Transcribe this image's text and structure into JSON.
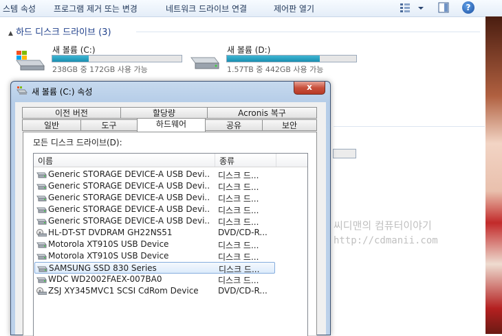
{
  "toolbar": {
    "items": [
      "스템 속성",
      "프로그램 제거 또는 변경",
      "네트워크 드라이브 연결",
      "제어판 열기"
    ],
    "help_label": "?"
  },
  "explorer": {
    "section_title": "하드 디스크 드라이브 (3)",
    "drives": [
      {
        "name": "새 볼륨 (C:)",
        "space": "238GB 중 172GB 사용 가능",
        "used_fraction": 0.28
      },
      {
        "name": "새 볼륨 (D:)",
        "space": "1.57TB 중 442GB 사용 가능",
        "used_fraction": 0.72
      }
    ],
    "watermark_title": "씨디맨의 컴퓨터이야기",
    "watermark_url": "http://cdmanii.com"
  },
  "dialog": {
    "title": "새 볼륨 (C:) 속성",
    "close_label": "x",
    "tabs_row1": [
      "이전 버전",
      "할당량",
      "Acronis 복구"
    ],
    "tabs_row2": [
      "일반",
      "도구",
      "하드웨어",
      "공유",
      "보안"
    ],
    "active_tab": "하드웨어",
    "panel_label": "모든 디스크 드라이브(D):",
    "columns": [
      "이름",
      "종류"
    ],
    "devices": [
      {
        "name": "Generic STORAGE DEVICE-A USB Devi...",
        "type": "디스크 드...",
        "icon": "hdd-icon"
      },
      {
        "name": "Generic STORAGE DEVICE-A USB Devi...",
        "type": "디스크 드...",
        "icon": "hdd-icon"
      },
      {
        "name": "Generic STORAGE DEVICE-A USB Devi...",
        "type": "디스크 드...",
        "icon": "hdd-icon"
      },
      {
        "name": "Generic STORAGE DEVICE-A USB Devi...",
        "type": "디스크 드...",
        "icon": "hdd-icon"
      },
      {
        "name": "Generic STORAGE DEVICE-A USB Devi...",
        "type": "디스크 드...",
        "icon": "hdd-icon"
      },
      {
        "name": "HL-DT-ST DVDRAM GH22NS51",
        "type": "DVD/CD-R...",
        "icon": "optical-drive-icon"
      },
      {
        "name": "Motorola XT910S USB Device",
        "type": "디스크 드...",
        "icon": "hdd-icon"
      },
      {
        "name": "Motorola XT910S USB Device",
        "type": "디스크 드...",
        "icon": "hdd-icon"
      },
      {
        "name": "SAMSUNG SSD 830 Series",
        "type": "디스크 드...",
        "icon": "hdd-icon"
      },
      {
        "name": "WDC WD2002FAEX-007BA0",
        "type": "디스크 드...",
        "icon": "hdd-icon"
      },
      {
        "name": "ZSJ XY345MVC1 SCSI CdRom Device",
        "type": "DVD/CD-R...",
        "icon": "optical-drive-icon"
      }
    ],
    "selected_index": 8
  }
}
